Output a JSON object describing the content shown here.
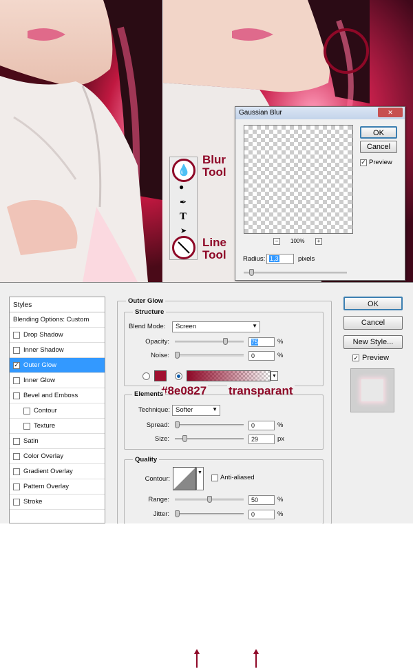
{
  "annotations": {
    "blur_tool_line1": "Blur",
    "blur_tool_line2": "Tool",
    "line_tool_line1": "Line",
    "line_tool_line2": "Tool",
    "color_label": "#8e0827",
    "transparent_label": "transparant",
    "color": "#8e0827"
  },
  "gaussian": {
    "title": "Gaussian Blur",
    "ok": "OK",
    "cancel": "Cancel",
    "preview": "Preview",
    "zoom": "100%",
    "zoom_out": "−",
    "zoom_in": "+",
    "radius_label": "Radius:",
    "radius_value": "1,3",
    "radius_unit": "pixels",
    "close": "✕"
  },
  "layer_style": {
    "styles_header": "Styles",
    "blending": "Blending Options: Custom",
    "items": [
      {
        "label": "Drop Shadow",
        "checked": false,
        "active": false,
        "indent": false
      },
      {
        "label": "Inner Shadow",
        "checked": false,
        "active": false,
        "indent": false
      },
      {
        "label": "Outer Glow",
        "checked": true,
        "active": true,
        "indent": false
      },
      {
        "label": "Inner Glow",
        "checked": false,
        "active": false,
        "indent": false
      },
      {
        "label": "Bevel and Emboss",
        "checked": false,
        "active": false,
        "indent": false
      },
      {
        "label": "Contour",
        "checked": false,
        "active": false,
        "indent": true
      },
      {
        "label": "Texture",
        "checked": false,
        "active": false,
        "indent": true
      },
      {
        "label": "Satin",
        "checked": false,
        "active": false,
        "indent": false
      },
      {
        "label": "Color Overlay",
        "checked": false,
        "active": false,
        "indent": false
      },
      {
        "label": "Gradient Overlay",
        "checked": false,
        "active": false,
        "indent": false
      },
      {
        "label": "Pattern Overlay",
        "checked": false,
        "active": false,
        "indent": false
      },
      {
        "label": "Stroke",
        "checked": false,
        "active": false,
        "indent": false
      }
    ],
    "outer_glow_title": "Outer Glow",
    "structure": "Structure",
    "blend_mode_label": "Blend Mode:",
    "blend_mode_value": "Screen",
    "opacity_label": "Opacity:",
    "opacity_value": "75",
    "noise_label": "Noise:",
    "noise_value": "0",
    "percent": "%",
    "px": "px",
    "elements": "Elements",
    "technique_label": "Technique:",
    "technique_value": "Softer",
    "spread_label": "Spread:",
    "spread_value": "0",
    "size_label": "Size:",
    "size_value": "29",
    "quality": "Quality",
    "contour_label": "Contour:",
    "anti_aliased": "Anti-aliased",
    "range_label": "Range:",
    "range_value": "50",
    "jitter_label": "Jitter:",
    "jitter_value": "0",
    "ok": "OK",
    "cancel": "Cancel",
    "new_style": "New Style...",
    "preview": "Preview",
    "glow_color": "#a01030",
    "opacity_level": 0.75,
    "noise_level": 0,
    "spread_level": 0,
    "size_level": 0.12,
    "range_level": 0.5,
    "jitter_level": 0
  }
}
